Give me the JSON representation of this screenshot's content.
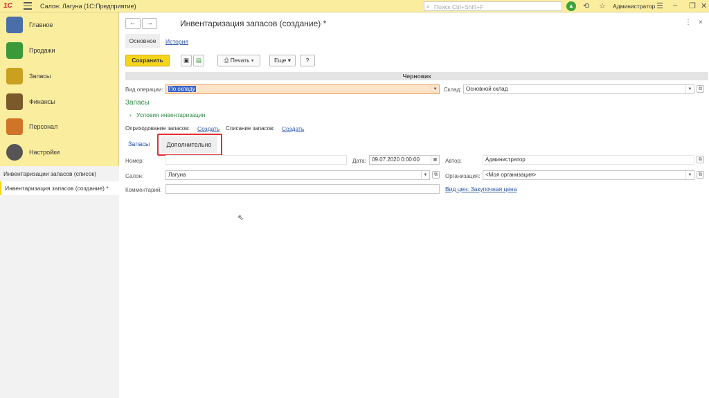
{
  "titlebar": {
    "logo": "1С",
    "app_title": "Салон: Лагуна  (1С:Предприятие)",
    "search_placeholder": "Поиск Ctrl+Shift+F",
    "user": "Администратор"
  },
  "sidebar": {
    "items": [
      {
        "label": "Главное",
        "icon": "main-icon",
        "color": "#4a6ea8"
      },
      {
        "label": "Продажи",
        "icon": "sales-chart-icon",
        "color": "#3a9a3a"
      },
      {
        "label": "Запасы",
        "icon": "stock-icon",
        "color": "#c9a020"
      },
      {
        "label": "Финансы",
        "icon": "wallet-icon",
        "color": "#7a5a2a"
      },
      {
        "label": "Персонал",
        "icon": "staff-icon",
        "color": "#d0742a"
      },
      {
        "label": "Настройки",
        "icon": "gear-icon",
        "color": "#555555"
      }
    ],
    "open_windows": [
      "Инвентаризации запасов (список)",
      "Инвентаризация запасов (создание) *"
    ]
  },
  "form": {
    "title": "Инвентаризация запасов (создание) *",
    "tabs": [
      "Основное",
      "История"
    ],
    "toolbar": {
      "save": "Сохранить",
      "print": "Печать",
      "more": "Еще",
      "help": "?"
    },
    "status": "Черновик",
    "operation_label": "Вид операции:",
    "operation_value": "По складу",
    "warehouse_label": "Склад:",
    "warehouse_value": "Основной склад",
    "section_title": "Запасы",
    "conditions_link": "Условия инвентаризации",
    "receipt_label": "Оприходование запасов:",
    "receipt_link": "Создать",
    "writeoff_label": "Списание запасов:",
    "writeoff_link": "Создать",
    "inner_tabs": [
      "Запасы",
      "Дополнительно"
    ],
    "number_label": "Номер:",
    "number_value": "",
    "date_label": "Дата:",
    "date_value": "09.07.2020  0:00:00",
    "author_label": "Автор:",
    "author_value": "Администратор",
    "salon_label": "Салон:",
    "salon_value": "Лагуна",
    "org_label": "Организация:",
    "org_value": "<Моя организация>",
    "comment_label": "Комментарий:",
    "comment_value": "",
    "price_link": "Вид цен: Закупочная цена"
  }
}
